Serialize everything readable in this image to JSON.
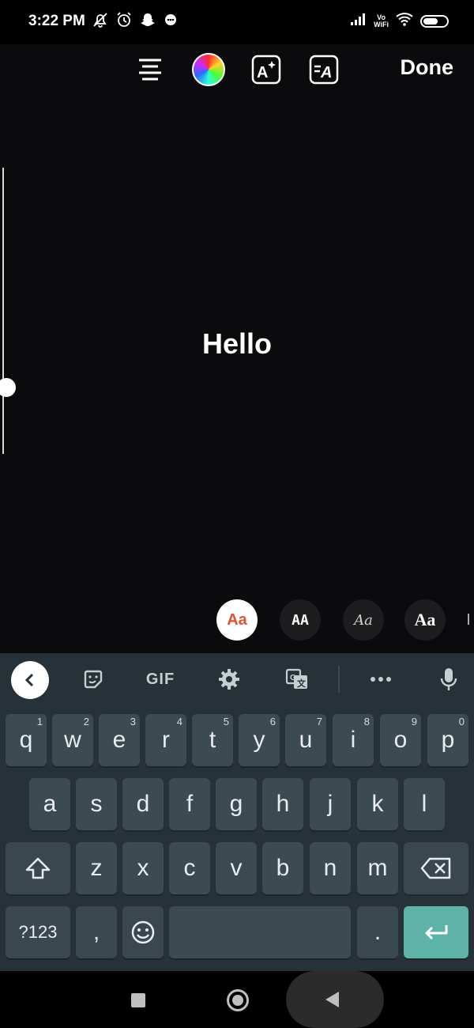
{
  "status_bar": {
    "time": "3:22 PM",
    "icons": [
      "silent-bell-icon",
      "alarm-icon",
      "snapchat-icon",
      "chat-bubble-icon"
    ],
    "vowifi": [
      "Vo",
      "WiFi"
    ],
    "battery": "55"
  },
  "toolbar": {
    "done_label": "Done",
    "colors": {
      "accent_done": "#ffffff"
    }
  },
  "canvas": {
    "text": "Hello",
    "size_slider_value": 0.74
  },
  "font_styles": [
    "Aa",
    "AA",
    "Aa",
    "Aa"
  ],
  "keyboard": {
    "top_icons": [
      "back-icon",
      "sticker-icon",
      "gif",
      "settings-icon",
      "translate-icon",
      "more-icon",
      "mic-icon"
    ],
    "gif_label": "GIF",
    "row1": [
      {
        "k": "q",
        "h": "1"
      },
      {
        "k": "w",
        "h": "2"
      },
      {
        "k": "e",
        "h": "3"
      },
      {
        "k": "r",
        "h": "4"
      },
      {
        "k": "t",
        "h": "5"
      },
      {
        "k": "y",
        "h": "6"
      },
      {
        "k": "u",
        "h": "7"
      },
      {
        "k": "i",
        "h": "8"
      },
      {
        "k": "o",
        "h": "9"
      },
      {
        "k": "p",
        "h": "0"
      }
    ],
    "row2": [
      "a",
      "s",
      "d",
      "f",
      "g",
      "h",
      "j",
      "k",
      "l"
    ],
    "row3": [
      "z",
      "x",
      "c",
      "v",
      "b",
      "n",
      "m"
    ],
    "symbols_label": "?123",
    "comma": ",",
    "period": ".",
    "enter_color": "#5db3a8"
  }
}
